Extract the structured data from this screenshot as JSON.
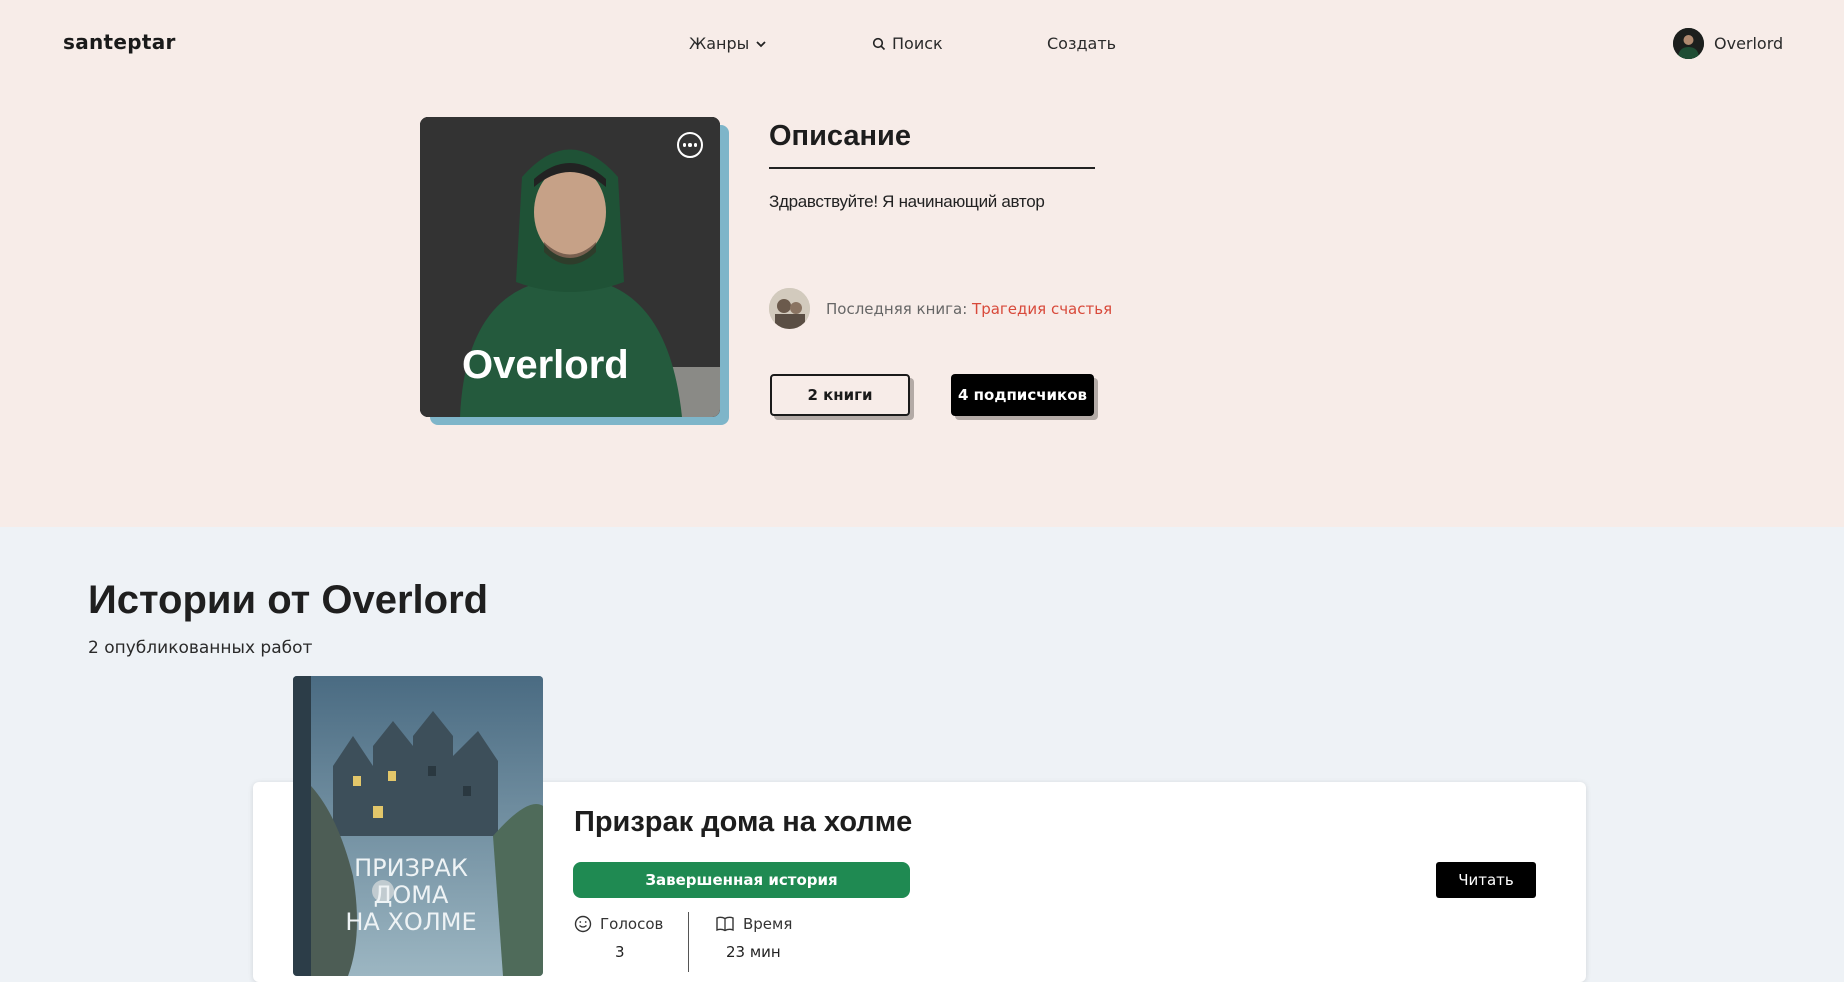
{
  "header": {
    "logo": "santeptar",
    "nav": {
      "genres": "Жанры",
      "search": "Поиск",
      "create": "Создать"
    },
    "user_name": "Overlord"
  },
  "profile": {
    "name": "Overlord",
    "description_title": "Описание",
    "description": "Здравствуйте! Я начинающий автор",
    "last_book_label": "Последняя книга:",
    "last_book_title": "Трагедия счастья",
    "books_button": "2 книги",
    "subscribers_button": "4 подписчиков"
  },
  "stories": {
    "title": "Истории от Overlord",
    "subtitle": "2 опубликованных работ",
    "items": [
      {
        "title": "Призрак дома на холме",
        "status": "Завершенная история",
        "read_label": "Читать",
        "votes_label": "Голосов",
        "votes_value": "3",
        "time_label": "Время",
        "time_value": "23 мин",
        "cover_text_lines": [
          "ПРИЗРАК",
          "ДОМА",
          "НА ХОЛМЕ"
        ]
      }
    ]
  },
  "colors": {
    "top_bg": "#f7ece8",
    "bottom_bg": "#eef2f6",
    "card_shadow": "#7eb5c9",
    "link_red": "#d8493a",
    "status_green": "#1f8a52"
  }
}
